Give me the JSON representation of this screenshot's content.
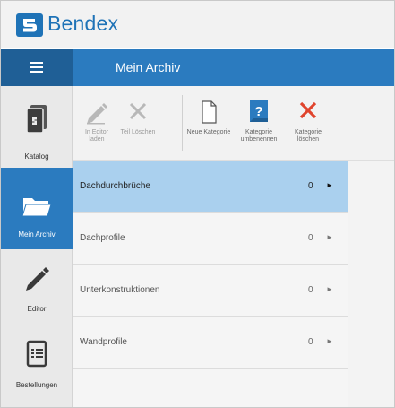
{
  "app": {
    "brand": "Bendex"
  },
  "header": {
    "title": "Mein Archiv",
    "menu_icon": "hamburger-icon"
  },
  "nav": [
    {
      "label": "Katalog",
      "icon": "book-icon",
      "active": false
    },
    {
      "label": "Mein Archiv",
      "icon": "folder-icon",
      "active": true
    },
    {
      "label": "Editor",
      "icon": "pencil-icon",
      "active": false
    },
    {
      "label": "Bestellungen",
      "icon": "clipboard-icon",
      "active": false
    }
  ],
  "toolbar": {
    "edit_line1": "In Editor",
    "edit_line2": "laden",
    "delete_part": "Teil Löschen",
    "new_category": "Neue Kategorie",
    "rename_line1": "Kategorie",
    "rename_line2": "umbenennen",
    "delete_cat_line1": "Kategorie",
    "delete_cat_line2": "löschen"
  },
  "categories": [
    {
      "name": "Dachdurchbrüche",
      "count": "0",
      "selected": true
    },
    {
      "name": "Dachprofile",
      "count": "0",
      "selected": false
    },
    {
      "name": "Unterkonstruktionen",
      "count": "0",
      "selected": false
    },
    {
      "name": "Wandprofile",
      "count": "0",
      "selected": false
    }
  ],
  "colors": {
    "brand": "#1f73b7",
    "header": "#2b7bbf",
    "menu_button": "#1f5f96",
    "selected_row": "#aad0ee",
    "delete_red": "#e0442d"
  }
}
